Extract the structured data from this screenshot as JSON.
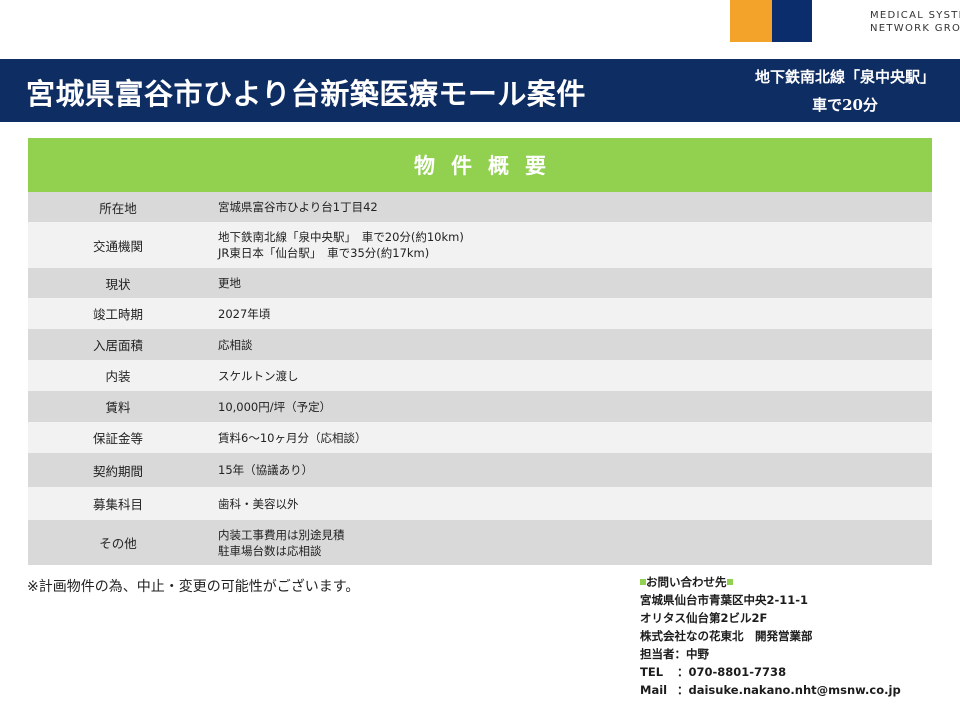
{
  "logo": {
    "line1": "MEDICAL SYSTEM",
    "line2": "NETWORK GROUP",
    "orange_color": "#f3a32a",
    "navy_color": "#0b2d6b"
  },
  "banner": {
    "title": "宮城県富谷市ひより台新築医療モール案件",
    "access_line1": "地下鉄南北線「泉中央駅」",
    "access_line2": "車で20分"
  },
  "table": {
    "heading": "物件概要",
    "rows": [
      {
        "label": "所在地",
        "lines": [
          "宮城県富谷市ひより台1丁目42"
        ]
      },
      {
        "label": "交通機関",
        "lines": [
          "地下鉄南北線「泉中央駅」　車で20分(約10km)",
          "JR東日本「仙台駅」　車で35分(約17km)"
        ]
      },
      {
        "label": "現状",
        "lines": [
          "更地"
        ]
      },
      {
        "label": "竣工時期",
        "lines": [
          "2027年頃"
        ]
      },
      {
        "label": "入居面積",
        "lines": [
          "応相談"
        ]
      },
      {
        "label": "内装",
        "lines": [
          "スケルトン渡し"
        ]
      },
      {
        "label": "賃料",
        "lines": [
          "10,000円/坪（予定）"
        ]
      },
      {
        "label": "保証金等",
        "lines": [
          "賃料6～10ヶ月分（応相談）"
        ]
      },
      {
        "label": "契約期間",
        "lines": [
          "15年（協議あり）"
        ]
      },
      {
        "label": "募集科目",
        "lines": [
          "歯科・美容以外"
        ]
      },
      {
        "label": "その他",
        "lines": [
          "内装工事費用は別途見積",
          "駐車場台数は応相談"
        ]
      }
    ]
  },
  "note": "※計画物件の為、中止・変更の可能性がございます。",
  "contact": {
    "heading": "お問い合わせ先",
    "address1": "宮城県仙台市青葉区中央2-11-1",
    "address2": "オリタス仙台第2ビル2F",
    "company": "株式会社なの花東北　開発営業部",
    "person": "担当者：中野",
    "tel_label": "TEL",
    "tel": "：070-8801-7738",
    "mail_label": "Mail",
    "mail": "：daisuke.nakano.nht@msnw.co.jp"
  },
  "colors": {
    "banner_bg": "#0e2d63",
    "table_header": "#92d050",
    "row_dark": "#d9d9d9",
    "row_light": "#f2f2f2"
  }
}
